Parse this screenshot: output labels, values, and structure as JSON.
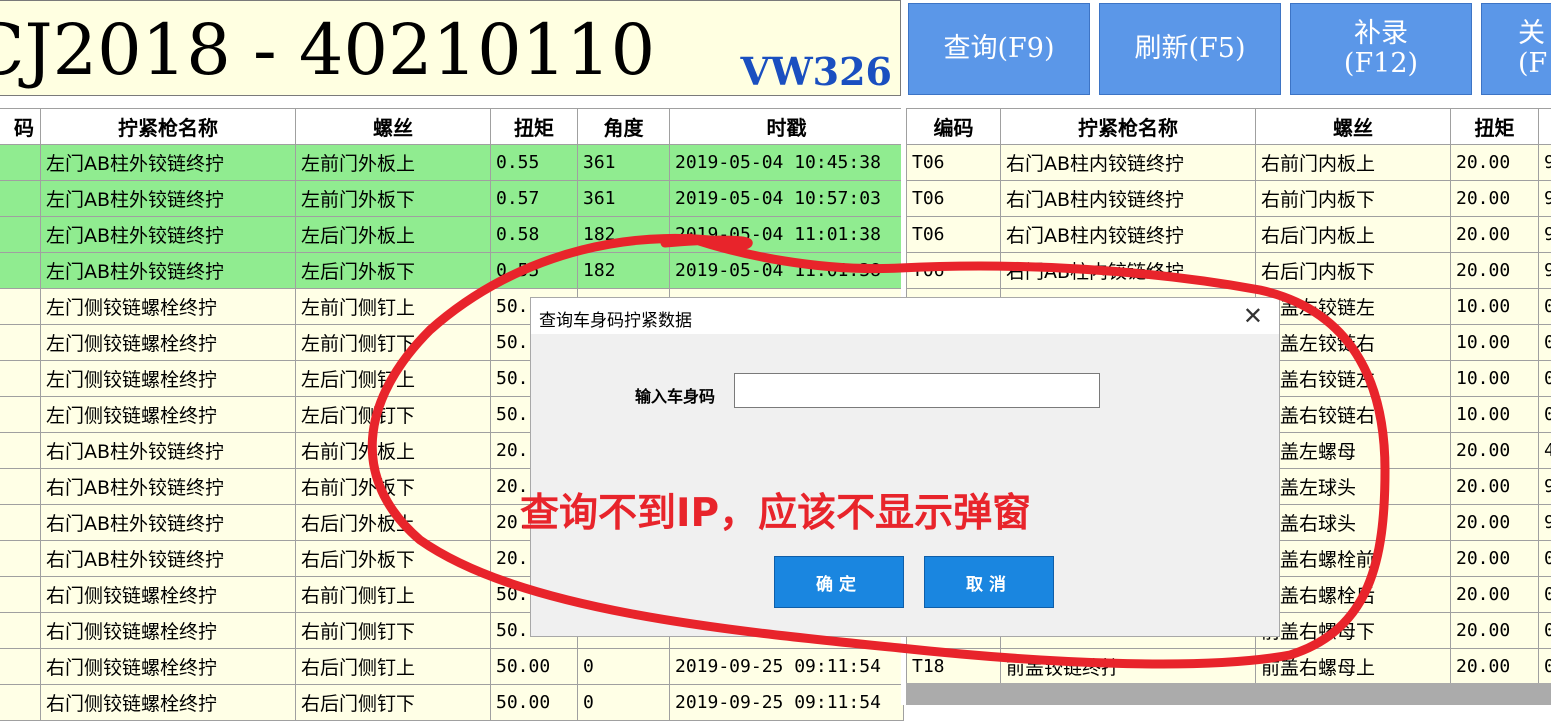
{
  "header": {
    "title": "CJ2018 - 40210110",
    "code": "VW326"
  },
  "toolbar": {
    "query_label": "查询(F9)",
    "refresh_label": "刷新(F5)",
    "supplement_line1": "补录",
    "supplement_line2": "(F12)",
    "close_line1": "关",
    "close_line2": "(F"
  },
  "left_table": {
    "headers": [
      "码",
      "拧紧枪名称",
      "螺丝",
      "扭矩",
      "角度",
      "时戳"
    ],
    "rows": [
      {
        "name": "左门AB柱外铰链终拧",
        "screw": "左前门外板上",
        "torque": "0.55",
        "angle": "361",
        "time": "2019-05-04 10:45:38",
        "hl": true
      },
      {
        "name": "左门AB柱外铰链终拧",
        "screw": "左前门外板下",
        "torque": "0.57",
        "angle": "361",
        "time": "2019-05-04 10:57:03",
        "hl": true
      },
      {
        "name": "左门AB柱外铰链终拧",
        "screw": "左后门外板上",
        "torque": "0.58",
        "angle": "182",
        "time": "2019-05-04 11:01:38",
        "hl": true
      },
      {
        "name": "左门AB柱外铰链终拧",
        "screw": "左后门外板下",
        "torque": "0.55",
        "angle": "182",
        "time": "2019-05-04 11:01:38",
        "hl": true
      },
      {
        "name": "左门侧铰链螺栓终拧",
        "screw": "左前门侧钉上",
        "torque": "50.",
        "angle": "",
        "time": "",
        "hl": false
      },
      {
        "name": "左门侧铰链螺栓终拧",
        "screw": "左前门侧钉下",
        "torque": "50.",
        "angle": "",
        "time": "",
        "hl": false
      },
      {
        "name": "左门侧铰链螺栓终拧",
        "screw": "左后门侧钉上",
        "torque": "50.",
        "angle": "",
        "time": "",
        "hl": false
      },
      {
        "name": "左门侧铰链螺栓终拧",
        "screw": "左后门侧钉下",
        "torque": "50.",
        "angle": "",
        "time": "",
        "hl": false
      },
      {
        "name": "右门AB柱外铰链终拧",
        "screw": "右前门外板上",
        "torque": "20.",
        "angle": "",
        "time": "",
        "hl": false
      },
      {
        "name": "右门AB柱外铰链终拧",
        "screw": "右前门外板下",
        "torque": "20.",
        "angle": "",
        "time": "",
        "hl": false
      },
      {
        "name": "右门AB柱外铰链终拧",
        "screw": "右后门外板上",
        "torque": "20.",
        "angle": "",
        "time": "",
        "hl": false
      },
      {
        "name": "右门AB柱外铰链终拧",
        "screw": "右后门外板下",
        "torque": "20.",
        "angle": "",
        "time": "",
        "hl": false
      },
      {
        "name": "右门侧铰链螺栓终拧",
        "screw": "右前门侧钉上",
        "torque": "50.",
        "angle": "",
        "time": "",
        "hl": false
      },
      {
        "name": "右门侧铰链螺栓终拧",
        "screw": "右前门侧钉下",
        "torque": "50.",
        "angle": "",
        "time": "",
        "hl": false
      },
      {
        "name": "右门侧铰链螺栓终拧",
        "screw": "右后门侧钉上",
        "torque": "50.00",
        "angle": "0",
        "time": "2019-09-25 09:11:54",
        "hl": false
      },
      {
        "name": "右门侧铰链螺栓终拧",
        "screw": "右后门侧钉下",
        "torque": "50.00",
        "angle": "0",
        "time": "2019-09-25 09:11:54",
        "hl": false
      }
    ]
  },
  "right_table": {
    "headers": [
      "编码",
      "拧紧枪名称",
      "螺丝",
      "扭矩",
      ""
    ],
    "rows": [
      {
        "code": "T06",
        "name": "右门AB柱内铰链终拧",
        "screw": "右前门内板上",
        "torque": "20.00",
        "extra": "9"
      },
      {
        "code": "T06",
        "name": "右门AB柱内铰链终拧",
        "screw": "右前门内板下",
        "torque": "20.00",
        "extra": "9"
      },
      {
        "code": "T06",
        "name": "右门AB柱内铰链终拧",
        "screw": "右后门内板上",
        "torque": "20.00",
        "extra": "9"
      },
      {
        "code": "T06",
        "name": "右门AB柱内铰链终拧",
        "screw": "右后门内板下",
        "torque": "20.00",
        "extra": "9"
      },
      {
        "code": "",
        "name": "",
        "screw": "前盖左铰链左",
        "torque": "10.00",
        "extra": "0"
      },
      {
        "code": "",
        "name": "",
        "screw": "前盖左铰链右",
        "torque": "10.00",
        "extra": "0"
      },
      {
        "code": "",
        "name": "",
        "screw": "前盖右铰链左",
        "torque": "10.00",
        "extra": "0"
      },
      {
        "code": "",
        "name": "",
        "screw": "前盖右铰链右",
        "torque": "10.00",
        "extra": "0"
      },
      {
        "code": "",
        "name": "",
        "screw": "前盖左螺母",
        "torque": "20.00",
        "extra": "4"
      },
      {
        "code": "",
        "name": "",
        "screw": "前盖左球头",
        "torque": "20.00",
        "extra": "9"
      },
      {
        "code": "",
        "name": "",
        "screw": "前盖右球头",
        "torque": "20.00",
        "extra": "9"
      },
      {
        "code": "",
        "name": "",
        "screw": "前盖右螺栓前",
        "torque": "20.00",
        "extra": "0"
      },
      {
        "code": "",
        "name": "",
        "screw": "前盖右螺栓后",
        "torque": "20.00",
        "extra": "0"
      },
      {
        "code": "",
        "name": "",
        "screw": "前盖右螺母下",
        "torque": "20.00",
        "extra": "0"
      },
      {
        "code": "T18",
        "name": "前盖铰链终拧",
        "screw": "前盖右螺母上",
        "torque": "20.00",
        "extra": "0"
      }
    ]
  },
  "dialog": {
    "title": "查询车身码拧紧数据",
    "close_glyph": "✕",
    "label": "输入车身码",
    "input_value": "",
    "ok_label": "确定",
    "cancel_label": "取消"
  },
  "annotation": {
    "text": "查询不到IP，应该不显示弹窗",
    "color": "#e8242b"
  }
}
